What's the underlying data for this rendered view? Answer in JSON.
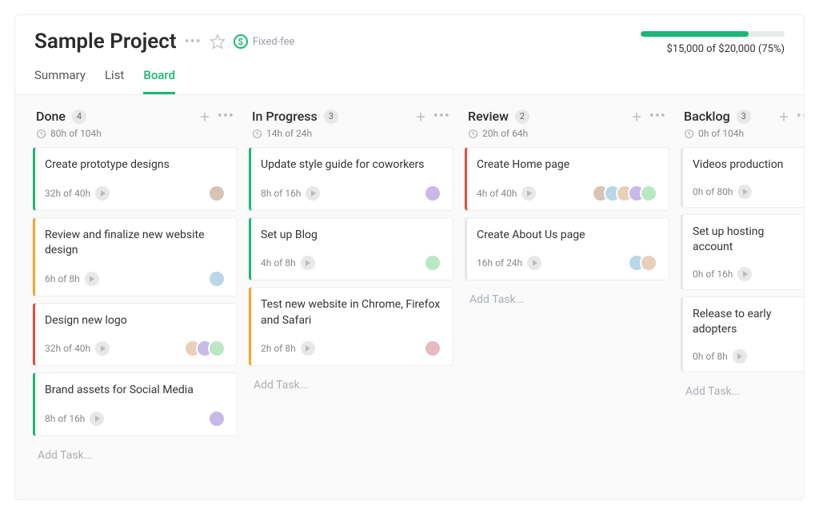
{
  "project": {
    "title": "Sample Project",
    "fee_type": "Fixed-fee"
  },
  "budget": {
    "text": "$15,000 of $20,000 (75%)",
    "percent": 75
  },
  "tabs": [
    {
      "label": "Summary",
      "active": false
    },
    {
      "label": "List",
      "active": false
    },
    {
      "label": "Board",
      "active": true
    }
  ],
  "add_task_label": "Add Task...",
  "status_colors": {
    "green": "#1bb776",
    "orange": "#f5a623",
    "red": "#e74c3c",
    "none": "#e6e6e6"
  },
  "avatar_palette": [
    "#d7c4b7",
    "#b9d7e8",
    "#e8d0b9",
    "#c9b9e8",
    "#b9e8c2",
    "#e8b9c2"
  ],
  "columns": [
    {
      "title": "Done",
      "count": 4,
      "hours": "80h of 104h",
      "cards": [
        {
          "title": "Create prototype designs",
          "hours": "32h of 40h",
          "status": "green",
          "avatars": 1
        },
        {
          "title": "Review and finalize new website design",
          "hours": "6h of 8h",
          "status": "orange",
          "avatars": 1
        },
        {
          "title": "Design new logo",
          "hours": "32h of 40h",
          "status": "red",
          "avatars": 3
        },
        {
          "title": "Brand assets for Social Media",
          "hours": "8h of 16h",
          "status": "green",
          "avatars": 1
        }
      ]
    },
    {
      "title": "In Progress",
      "count": 3,
      "hours": "14h of 24h",
      "cards": [
        {
          "title": "Update style guide for coworkers",
          "hours": "8h of 16h",
          "status": "green",
          "avatars": 1
        },
        {
          "title": "Set up Blog",
          "hours": "4h of 8h",
          "status": "green",
          "avatars": 1
        },
        {
          "title": "Test new website in Chrome, Firefox and Safari",
          "hours": "2h of 8h",
          "status": "orange",
          "avatars": 1
        }
      ]
    },
    {
      "title": "Review",
      "count": 2,
      "hours": "20h of 64h",
      "cards": [
        {
          "title": "Create Home page",
          "hours": "4h of 40h",
          "status": "red",
          "avatars": 5
        },
        {
          "title": "Create About Us page",
          "hours": "16h of 24h",
          "status": "none",
          "avatars": 2
        }
      ]
    },
    {
      "title": "Backlog",
      "count": 3,
      "hours": "0h of 104h",
      "cards": [
        {
          "title": "Videos production",
          "hours": "0h of 80h",
          "status": "none",
          "avatars": 0
        },
        {
          "title": "Set up hosting account",
          "hours": "0h of 16h",
          "status": "none",
          "avatars": 0
        },
        {
          "title": "Release to early adopters",
          "hours": "0h of 8h",
          "status": "none",
          "avatars": 0
        }
      ]
    }
  ]
}
